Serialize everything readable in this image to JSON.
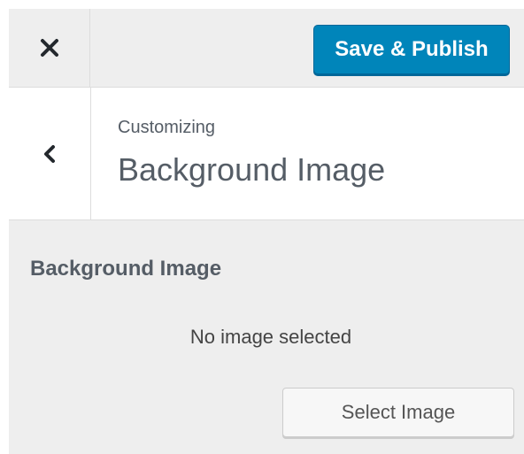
{
  "colors": {
    "publish_bg": "#0085ba",
    "panel_bg": "#eeeeee",
    "header_bg": "#ffffff",
    "text_muted": "#555d66"
  },
  "topbar": {
    "close_icon": "close-icon",
    "publish_label": "Save & Publish"
  },
  "section": {
    "back_icon": "chevron-left-icon",
    "crumb": "Customizing",
    "title": "Background Image"
  },
  "control": {
    "title": "Background Image",
    "status": "No image selected",
    "select_label": "Select Image"
  }
}
